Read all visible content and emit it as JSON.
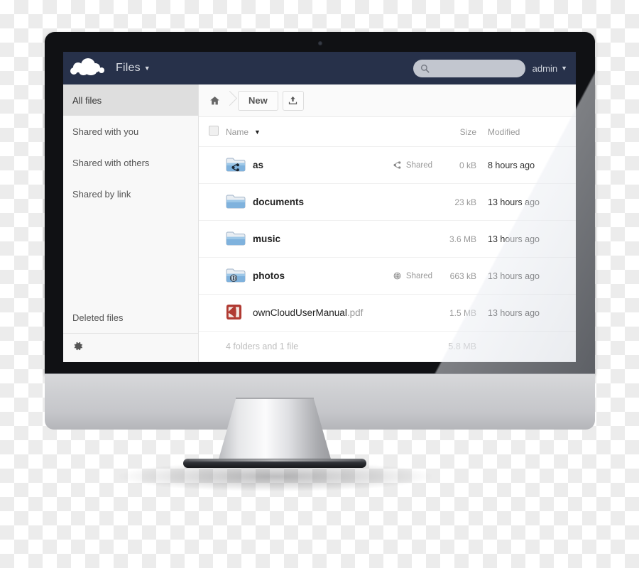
{
  "app": {
    "logo_name": "owncloud-logo",
    "title": "Files",
    "title_caret": "▼",
    "header_color": "#27314a"
  },
  "search": {
    "value": "",
    "placeholder": "",
    "icon": "search-icon"
  },
  "user": {
    "name": "admin",
    "caret": "▼"
  },
  "sidebar": {
    "items": [
      {
        "label": "All files",
        "active": true
      },
      {
        "label": "Shared with you",
        "active": false
      },
      {
        "label": "Shared with others",
        "active": false
      },
      {
        "label": "Shared by link",
        "active": false
      }
    ],
    "deleted": {
      "label": "Deleted files"
    },
    "settings_icon": "gear-icon"
  },
  "controls": {
    "home_icon": "home-icon",
    "new_label": "New",
    "upload_icon": "upload-icon"
  },
  "table": {
    "headers": {
      "name": "Name",
      "size": "Size",
      "modified": "Modified"
    },
    "sort_caret": "▼",
    "select_all": "select-all-checkbox",
    "rows": [
      {
        "name": "as",
        "ext": "",
        "type": "folder",
        "overlay": "share-icon",
        "shared_label": "Shared",
        "shared_icon": "share-icon",
        "size": "0 kB",
        "modified": "8 hours ago"
      },
      {
        "name": "documents",
        "ext": "",
        "type": "folder",
        "overlay": "",
        "shared_label": "",
        "shared_icon": "",
        "size": "23 kB",
        "modified": "13 hours ago"
      },
      {
        "name": "music",
        "ext": "",
        "type": "folder",
        "overlay": "",
        "shared_label": "",
        "shared_icon": "",
        "size": "3.6 MB",
        "modified": "13 hours ago"
      },
      {
        "name": "photos",
        "ext": "",
        "type": "folder",
        "overlay": "globe-icon",
        "shared_label": "Shared",
        "shared_icon": "globe-icon",
        "size": "663 kB",
        "modified": "13 hours ago"
      },
      {
        "name": "ownCloudUserManual",
        "ext": ".pdf",
        "type": "pdf",
        "overlay": "",
        "shared_label": "",
        "shared_icon": "",
        "size": "1.5 MB",
        "modified": "13 hours ago"
      }
    ],
    "summary": {
      "label": "4 folders and 1 file",
      "size": "5.8 MB"
    }
  }
}
